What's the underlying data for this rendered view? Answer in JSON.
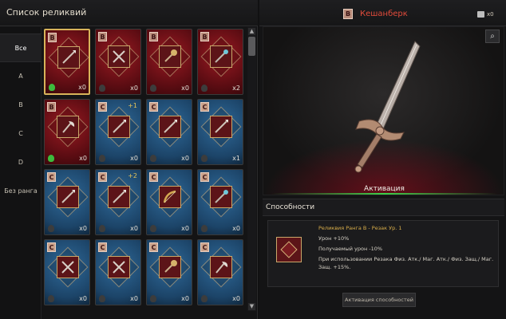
{
  "left": {
    "title": "Список реликвий",
    "categories": [
      "Все",
      "A",
      "B",
      "C",
      "D",
      "Без ранга"
    ]
  },
  "cards": [
    {
      "rank": "B",
      "qty": "x0",
      "flag": "green",
      "plus": "",
      "weapon": "spear"
    },
    {
      "rank": "B",
      "qty": "x0",
      "flag": "",
      "plus": "",
      "weapon": "cross"
    },
    {
      "rank": "B",
      "qty": "x0",
      "flag": "",
      "plus": "",
      "weapon": "mace"
    },
    {
      "rank": "B",
      "qty": "x2",
      "flag": "",
      "plus": "",
      "weapon": "staff"
    },
    {
      "rank": "B",
      "qty": "x0",
      "flag": "green",
      "plus": "",
      "weapon": "axe"
    },
    {
      "rank": "C",
      "qty": "x0",
      "flag": "",
      "plus": "+1",
      "weapon": "spear"
    },
    {
      "rank": "C",
      "qty": "x0",
      "flag": "",
      "plus": "",
      "weapon": "spear"
    },
    {
      "rank": "C",
      "qty": "x1",
      "flag": "",
      "plus": "",
      "weapon": "spear"
    },
    {
      "rank": "C",
      "qty": "x0",
      "flag": "",
      "plus": "",
      "weapon": "spear"
    },
    {
      "rank": "C",
      "qty": "x0",
      "flag": "",
      "plus": "+2",
      "weapon": "spear"
    },
    {
      "rank": "C",
      "qty": "x0",
      "flag": "",
      "plus": "",
      "weapon": "bow"
    },
    {
      "rank": "C",
      "qty": "x0",
      "flag": "",
      "plus": "",
      "weapon": "staff"
    },
    {
      "rank": "C",
      "qty": "x0",
      "flag": "",
      "plus": "",
      "weapon": "cross"
    },
    {
      "rank": "C",
      "qty": "x0",
      "flag": "",
      "plus": "",
      "weapon": "cross"
    },
    {
      "rank": "C",
      "qty": "x0",
      "flag": "",
      "plus": "",
      "weapon": "mace"
    },
    {
      "rank": "C",
      "qty": "x0",
      "flag": "",
      "plus": "",
      "weapon": "axe"
    }
  ],
  "right": {
    "rank": "B",
    "name": "Кешанберк",
    "count": "x0",
    "activation": "Активация",
    "abilities_title": "Способности",
    "ability_name": "Реликвия Ранга B - Резак Ур. 1",
    "lines": [
      "Урон +10%",
      "Получаемый урон -10%",
      "При использовании Резака Физ. Атк./ Маг. Атк./ Физ. Защ./ Маг.",
      "Защ. +15%."
    ],
    "activate_button": "Активация способностей"
  },
  "colors": {
    "rank_b": "#9b1a22",
    "rank_c": "#2f6a9a",
    "accent": "#e24b3b"
  }
}
